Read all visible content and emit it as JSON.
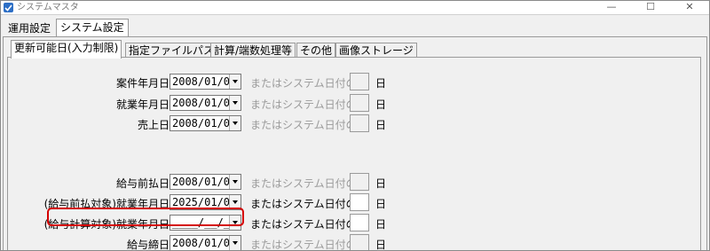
{
  "window": {
    "title": "システムマスタ",
    "minimize": "—",
    "maximize": "☐",
    "close": "✕"
  },
  "tabs": [
    {
      "label": "運用設定"
    },
    {
      "label": "システム設定"
    }
  ],
  "inner_tabs": [
    {
      "label": "更新可能日(入力制限)"
    },
    {
      "label": "指定ファイルパス"
    },
    {
      "label": "計算/端数処理等"
    },
    {
      "label": "その他"
    },
    {
      "label": "画像ストレージ"
    }
  ],
  "rows": [
    {
      "label": "案件年月日",
      "date": "2008/01/01",
      "or_text": "またはシステム日付の",
      "day": "日"
    },
    {
      "label": "就業年月日",
      "date": "2008/01/01",
      "or_text": "またはシステム日付の",
      "day": "日"
    },
    {
      "label": "売上日",
      "date": "2008/01/01",
      "or_text": "またはシステム日付の",
      "day": "日"
    },
    {
      "label": "給与前払日",
      "date": "2008/01/01",
      "or_text": "またはシステム日付の",
      "day": "日"
    },
    {
      "label": "(給与前払対象)就業年月日",
      "date": "2025/01/01",
      "or_text": "またはシステム日付の",
      "day": "日"
    },
    {
      "label": "(給与計算対象)就業年月日",
      "date": "____/__/__",
      "or_text": "またはシステム日付の",
      "day": "日"
    },
    {
      "label": "給与締日",
      "date": "2008/01/01",
      "or_text": "またはシステム日付の",
      "day": "日"
    }
  ],
  "colors": {
    "highlight": "#d40000",
    "accent": "#2d6fc6"
  }
}
